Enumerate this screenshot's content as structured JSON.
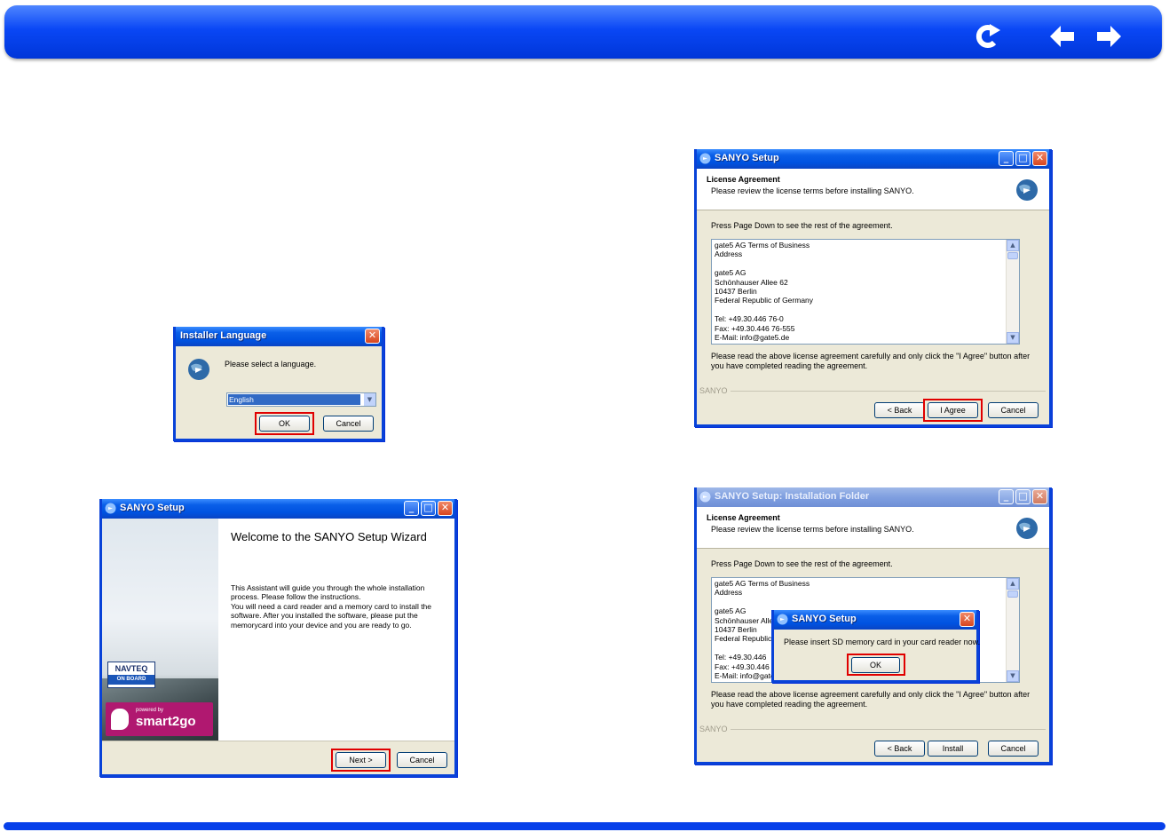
{
  "nav": {
    "icons": [
      "back-to-top-icon",
      "previous-page-icon",
      "next-page-icon"
    ],
    "color": "#0a47f5"
  },
  "lang_dialog": {
    "title": "Installer Language",
    "prompt": "Please select a language.",
    "selected_language": "English",
    "ok_label": "OK",
    "cancel_label": "Cancel"
  },
  "welcome_dialog": {
    "title": "SANYO Setup",
    "heading": "Welcome to the SANYO Setup Wizard",
    "body_lines": [
      "This Assistant will guide you through the whole installation",
      "process. Please follow the instructions.",
      "You will need a card reader and a memory card to install the",
      "software. After you installed the software, please put the",
      "memorycard into your device and you are ready to go."
    ],
    "navteq_line1": "NAVTEQ",
    "navteq_line2": "ON BOARD",
    "smart2go_small": "powered by",
    "smart2go_big": "smart2go",
    "next_label": "Next >",
    "cancel_label": "Cancel"
  },
  "license_dialog": {
    "title": "SANYO Setup",
    "header_title": "License Agreement",
    "header_subtitle": "Please review the license terms before installing SANYO.",
    "instruction": "Press Page Down to see the rest of the agreement.",
    "license_lines": [
      "gate5 AG Terms of Business",
      "Address",
      "",
      "gate5 AG",
      "Schönhauser Allee 62",
      "10437 Berlin",
      "Federal Republic of Germany",
      "",
      "Tel: +49.30.446 76-0",
      "Fax: +49.30.446 76-555",
      "E-Mail: info@gate5.de"
    ],
    "footer_line1": "Please read the above license agreement carefully and only click the \"I Agree\" button after",
    "footer_line2": "you have completed reading the agreement.",
    "brand": "SANYO",
    "back_label": "< Back",
    "agree_label": "I Agree",
    "cancel_label": "Cancel"
  },
  "folder_dialog": {
    "title": "SANYO Setup: Installation Folder",
    "header_title": "License Agreement",
    "header_subtitle": "Please review the license terms before installing SANYO.",
    "instruction": "Press Page Down to see the rest of the agreement.",
    "license_lines": [
      "gate5 AG Terms of Business",
      "Address",
      "",
      "gate5 AG",
      "Schönhauser Alle",
      "10437 Berlin",
      "Federal Republic",
      "",
      "Tel: +49.30.446",
      "Fax: +49.30.446",
      "E-Mail: info@gate"
    ],
    "footer_line1": "Please read the above license agreement carefully and only click the \"I Agree\" button after",
    "footer_line2": "you have completed reading the agreement.",
    "brand": "SANYO",
    "back_label": "< Back",
    "install_label": "Install",
    "cancel_label": "Cancel"
  },
  "popup": {
    "title": "SANYO Setup",
    "message": "Please insert SD memory card in your card reader now.",
    "ok_label": "OK"
  },
  "highlight_color": "#e00000"
}
